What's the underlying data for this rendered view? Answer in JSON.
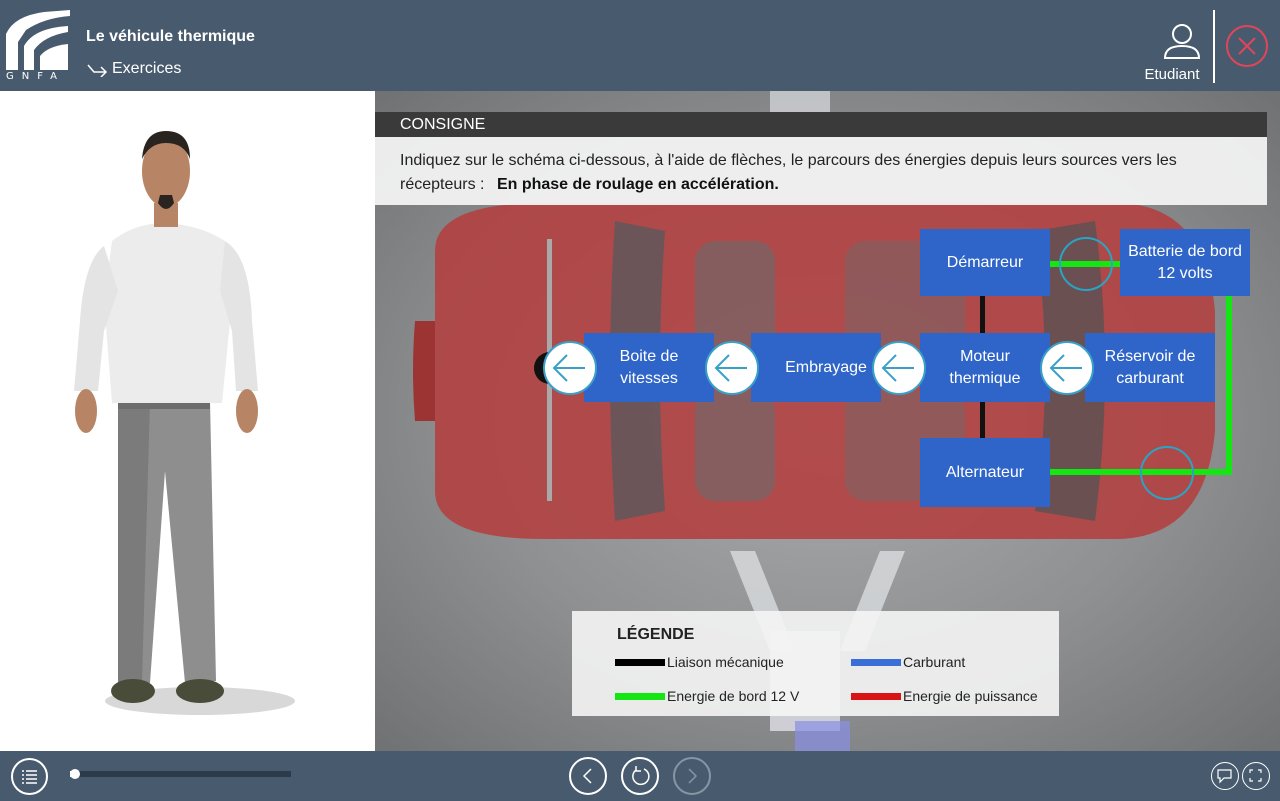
{
  "header": {
    "logo_text": "GNFA",
    "title": "Le véhicule thermique",
    "subtitle": "Exercices",
    "user_label": "Etudiant"
  },
  "consigne": {
    "heading": "CONSIGNE",
    "text": "Indiquez sur le schéma ci-dessous, à l'aide de flèches, le parcours des énergies depuis leurs sources vers les récepteurs :",
    "emphasis": "En phase de roulage en accélération."
  },
  "diagram": {
    "demarreur": "Démarreur",
    "batterie": "Batterie de bord 12 volts",
    "boite": "Boite de vitesses",
    "embrayage": "Embrayage",
    "moteur": "Moteur thermique",
    "reservoir": "Réservoir de carburant",
    "alternateur": "Alternateur"
  },
  "legend": {
    "title": "LÉGENDE",
    "items": [
      {
        "label": "Liaison mécanique",
        "color": "#000000"
      },
      {
        "label": "Carburant",
        "color": "#3a6fd8"
      },
      {
        "label": "Energie de bord 12 V",
        "color": "#14e614"
      },
      {
        "label": "Energie de puissance",
        "color": "#d81414"
      }
    ]
  },
  "footer": {
    "progress": 0.02
  },
  "colors": {
    "header_bg": "#485b6e",
    "box_blue": "#2f65c8",
    "close_red": "#e0455a",
    "line_green": "#14e614"
  }
}
